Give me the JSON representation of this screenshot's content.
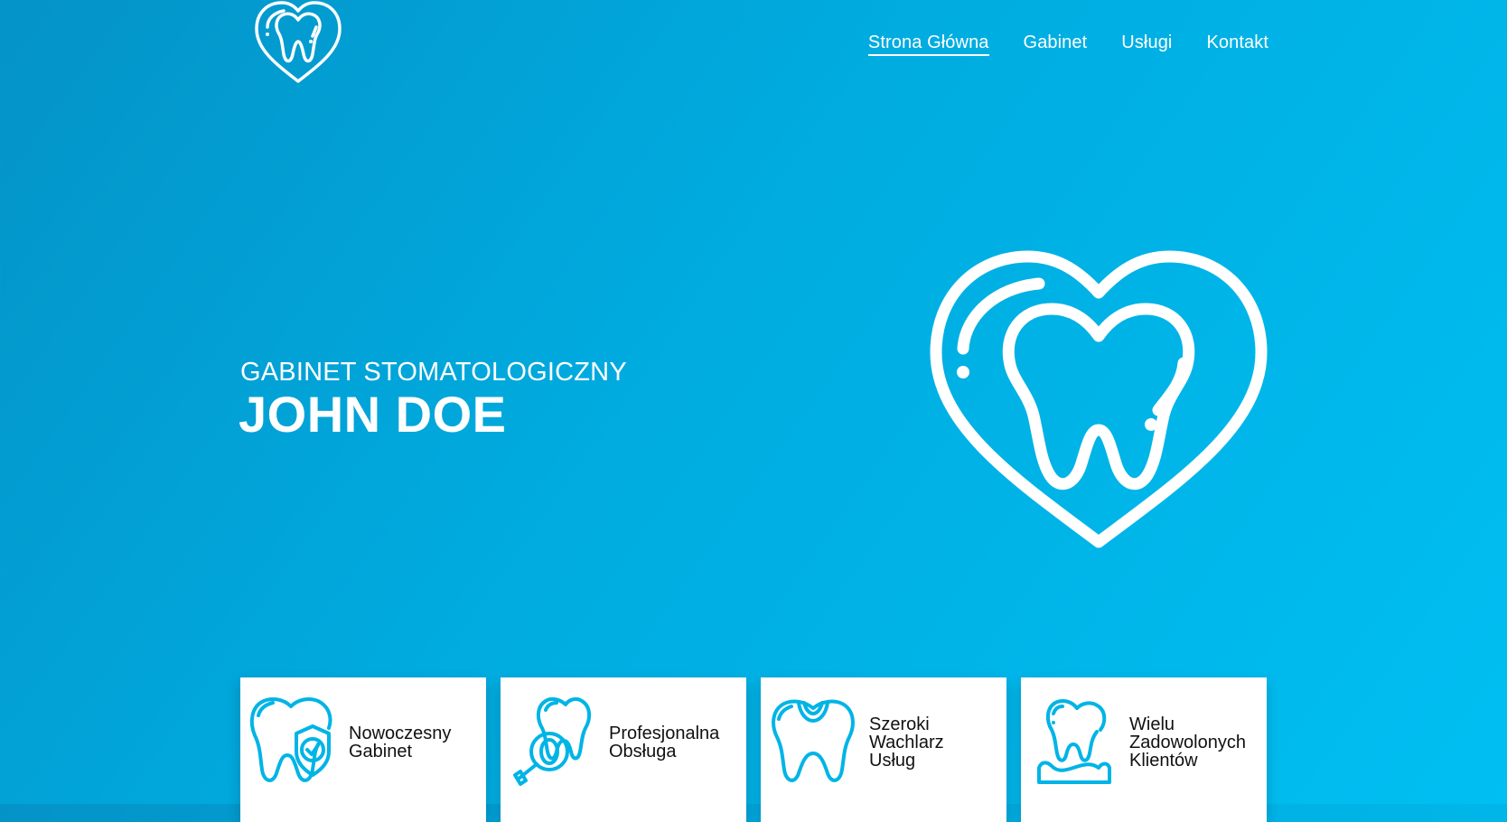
{
  "brand": {
    "logo_icon": "tooth-heart-icon"
  },
  "nav": {
    "items": [
      {
        "label": "Strona Główna",
        "active": true
      },
      {
        "label": "Gabinet",
        "active": false
      },
      {
        "label": "Usługi",
        "active": false
      },
      {
        "label": "Kontakt",
        "active": false
      }
    ]
  },
  "hero": {
    "subtitle": "GABINET STOMATOLOGICZNY",
    "title": "JOHN DOE",
    "illustration": "tooth-heart-icon"
  },
  "features": [
    {
      "label": "Nowoczesny\nGabinet",
      "icon": "tooth-shield-icon"
    },
    {
      "label": "Profesjonalna\nObsługa",
      "icon": "tooth-mirror-icon"
    },
    {
      "label": "Szeroki\nWachlarz\nUsług",
      "icon": "tooth-filling-icon"
    },
    {
      "label": "Wielu\nZadowolonych\nKlientów",
      "icon": "tooth-denture-icon"
    }
  ],
  "colors": {
    "accent": "#00b4e6",
    "background_start": "#0493c8",
    "background_end": "#00bff2",
    "card": "#ffffff",
    "text_dark": "#111111"
  }
}
